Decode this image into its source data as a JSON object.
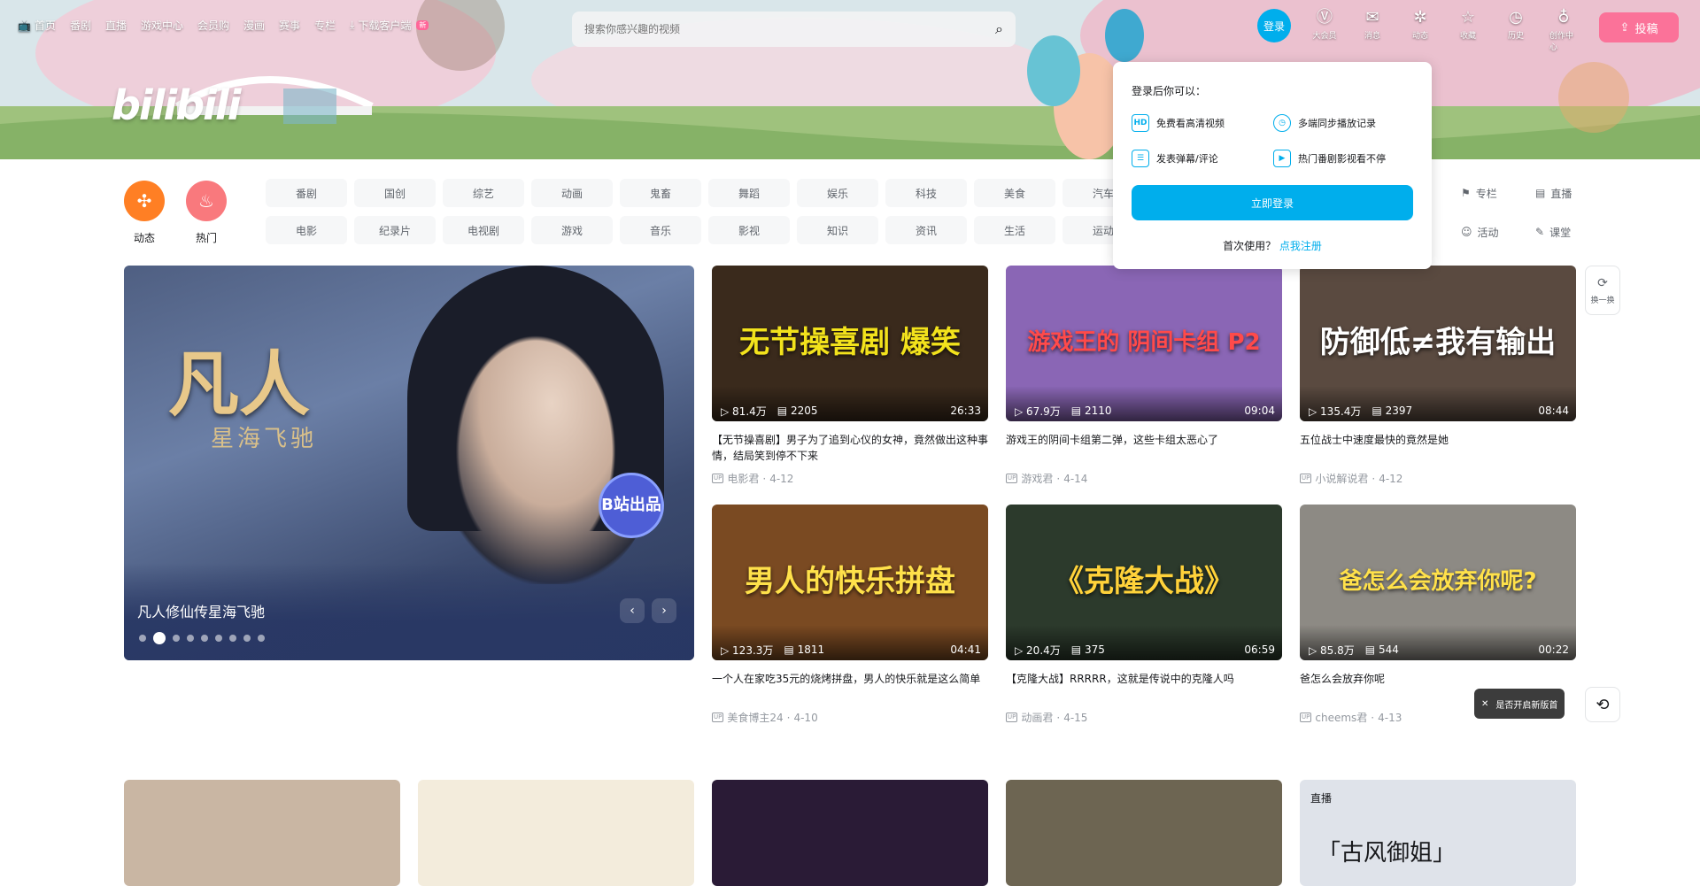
{
  "header": {
    "nav": [
      {
        "label": "首页",
        "icon": "tv-icon"
      },
      {
        "label": "番剧"
      },
      {
        "label": "直播"
      },
      {
        "label": "游戏中心"
      },
      {
        "label": "会员购"
      },
      {
        "label": "漫画"
      },
      {
        "label": "赛事"
      },
      {
        "label": "专栏"
      }
    ],
    "download": {
      "label": "下载客户端",
      "badge": "新"
    },
    "logo": "bilibili",
    "search": {
      "placeholder": "搜索你感兴趣的视频"
    },
    "login_label": "登录",
    "right_nav": [
      {
        "label": "大会员",
        "icon": "vip-icon",
        "glyph": "Ⓥ"
      },
      {
        "label": "消息",
        "icon": "mail-icon",
        "glyph": "✉"
      },
      {
        "label": "动态",
        "icon": "wind-icon",
        "glyph": "✲"
      },
      {
        "label": "收藏",
        "icon": "star-icon",
        "glyph": "☆"
      },
      {
        "label": "历史",
        "icon": "clock-icon",
        "glyph": "◷"
      },
      {
        "label": "创作中心",
        "icon": "bulb-icon",
        "glyph": "♁"
      }
    ],
    "upload_label": "投稿"
  },
  "channels": {
    "dynamic": {
      "label": "动态",
      "color": "#ff7f24"
    },
    "hot": {
      "label": "热门",
      "color": "#f9797d"
    },
    "tags": [
      "番剧",
      "国创",
      "综艺",
      "动画",
      "鬼畜",
      "舞蹈",
      "娱乐",
      "科技",
      "美食",
      "汽车",
      "电影",
      "纪录片",
      "电视剧",
      "游戏",
      "音乐",
      "影视",
      "知识",
      "资讯",
      "生活",
      "运动"
    ],
    "right_tags": [
      {
        "label": "专栏",
        "icon": "flag-icon",
        "glyph": "⚑"
      },
      {
        "label": "直播",
        "icon": "live-icon",
        "glyph": "▤"
      },
      {
        "label": "活动",
        "icon": "smile-icon",
        "glyph": "☺"
      },
      {
        "label": "课堂",
        "icon": "edit-icon",
        "glyph": "✎"
      }
    ]
  },
  "hero": {
    "art_title": "凡人",
    "art_sub": "星海飞驰",
    "stamp": "B站出品",
    "caption": "凡人修仙传星海飞驰",
    "prev": "‹",
    "next": "›",
    "slide_count": 9,
    "active_slide": 1
  },
  "videos": [
    {
      "views": "81.4万",
      "danmaku": "2205",
      "duration": "26:33",
      "art": "无节操喜剧 爆笑",
      "title": "【无节操喜剧】男子为了追到心仪的女神，竟然做出这种事情，结局笑到停不下来",
      "author": "电影君",
      "date": "4-12",
      "bg": "#3a2a1c",
      "art_color": "#f2e21c"
    },
    {
      "views": "67.9万",
      "danmaku": "2110",
      "duration": "09:04",
      "art": "游戏王的 阴间卡组 P2",
      "title": "游戏王的阴间卡组第二弹，这些卡组太恶心了",
      "author": "游戏君",
      "date": "4-14",
      "bg": "#8a66b5",
      "art_color": "#ff4a4a"
    },
    {
      "views": "135.4万",
      "danmaku": "2397",
      "duration": "08:44",
      "art": "防御低≠我有输出",
      "title": "五位战士中速度最快的竟然是她",
      "author": "小说解说君",
      "date": "4-12",
      "bg": "#5a4a40",
      "art_color": "#ffffff"
    },
    {
      "views": "123.3万",
      "danmaku": "1811",
      "duration": "04:41",
      "art": "男人的快乐拼盘",
      "title": "一个人在家吃35元的烧烤拼盘，男人的快乐就是这么简单",
      "author": "美食博主24",
      "date": "4-10",
      "bg": "#7a4a22",
      "art_color": "#ffe14a"
    },
    {
      "views": "20.4万",
      "danmaku": "375",
      "duration": "06:59",
      "art": "《克隆大战》",
      "title": "【克隆大战】RRRRR，这就是传说中的克隆人吗",
      "author": "动画君",
      "date": "4-15",
      "bg": "#2c3a2c",
      "art_color": "#ffd23a"
    },
    {
      "views": "85.8万",
      "danmaku": "544",
      "duration": "00:22",
      "art": "爸怎么会放弃你呢?",
      "title": "爸怎么会放弃你呢",
      "author": "cheems君",
      "date": "4-13",
      "bg": "#8d8a84",
      "art_color": "#ffe14a"
    }
  ],
  "bottom_row": [
    {
      "bg": "#c9b6a3",
      "label": ""
    },
    {
      "bg": "#f3ecdc",
      "label": ""
    },
    {
      "bg": "#2a1b36",
      "label": ""
    },
    {
      "bg": "#6d6552",
      "label": ""
    },
    {
      "bg": "#dfe3ea",
      "label": "直播",
      "art": "「古风御姐」"
    }
  ],
  "refresh_label": "换一换",
  "toast": {
    "text": "是否开启新版首页推荐",
    "close": "✕"
  },
  "login_popup": {
    "title": "登录后你可以：",
    "perks": [
      {
        "label": "免费看高清视频",
        "badge": "HD"
      },
      {
        "label": "多端同步播放记录",
        "badge": "◷"
      },
      {
        "label": "发表弹幕/评论",
        "badge": "☰"
      },
      {
        "label": "热门番剧影视看不停",
        "badge": "▶"
      }
    ],
    "login_button": "立即登录",
    "register_prompt": "首次使用？",
    "register_link": "点我注册"
  }
}
